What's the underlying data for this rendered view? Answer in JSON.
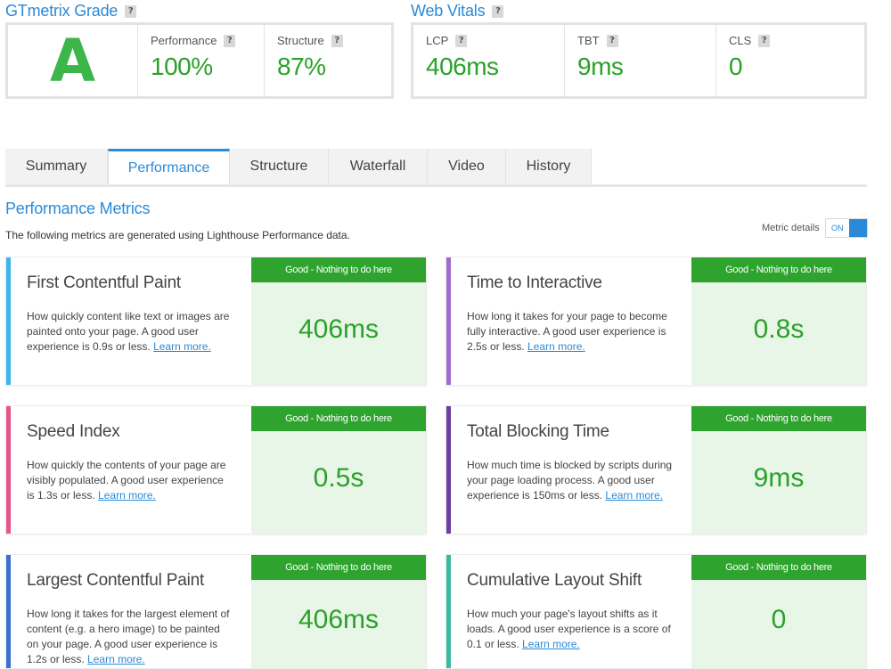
{
  "grade": {
    "title": "GTmetrix Grade",
    "letter": "A",
    "performance_label": "Performance",
    "performance_value": "100%",
    "structure_label": "Structure",
    "structure_value": "87%"
  },
  "vitals": {
    "title": "Web Vitals",
    "items": [
      {
        "label": "LCP",
        "value": "406ms"
      },
      {
        "label": "TBT",
        "value": "9ms"
      },
      {
        "label": "CLS",
        "value": "0"
      }
    ]
  },
  "help_glyph": "?",
  "tabs": [
    "Summary",
    "Performance",
    "Structure",
    "Waterfall",
    "Video",
    "History"
  ],
  "active_tab": "Performance",
  "metrics_section": {
    "title": "Performance Metrics",
    "subtitle": "The following metrics are generated using Lighthouse Performance data.",
    "toggle_label": "Metric details",
    "toggle_state": "ON"
  },
  "cards": [
    {
      "title": "First Contentful Paint",
      "desc": "How quickly content like text or images are painted onto your page. A good user experience is 0.9s or less.",
      "link": "Learn more.",
      "badge": "Good - Nothing to do here",
      "value": "406ms",
      "color": "#3bb6e6"
    },
    {
      "title": "Time to Interactive",
      "desc": "How long it takes for your page to become fully interactive. A good user experience is 2.5s or less.",
      "link": "Learn more.",
      "badge": "Good - Nothing to do here",
      "value": "0.8s",
      "color": "#a26bcf"
    },
    {
      "title": "Speed Index",
      "desc": "How quickly the contents of your page are visibly populated. A good user experience is 1.3s or less.",
      "link": "Learn more.",
      "badge": "Good - Nothing to do here",
      "value": "0.5s",
      "color": "#e8558c"
    },
    {
      "title": "Total Blocking Time",
      "desc": "How much time is blocked by scripts during your page loading process. A good user experience is 150ms or less.",
      "link": "Learn more.",
      "badge": "Good - Nothing to do here",
      "value": "9ms",
      "color": "#6d3fa0"
    },
    {
      "title": "Largest Contentful Paint",
      "desc": "How long it takes for the largest element of content (e.g. a hero image) to be painted on your page. A good user experience is 1.2s or less.",
      "link": "Learn more.",
      "badge": "Good - Nothing to do here",
      "value": "406ms",
      "color": "#3b6fd1"
    },
    {
      "title": "Cumulative Layout Shift",
      "desc": "How much your page's layout shifts as it loads. A good user experience is a score of 0.1 or less.",
      "link": "Learn more.",
      "badge": "Good - Nothing to do here",
      "value": "0",
      "color": "#3db8a0"
    }
  ]
}
